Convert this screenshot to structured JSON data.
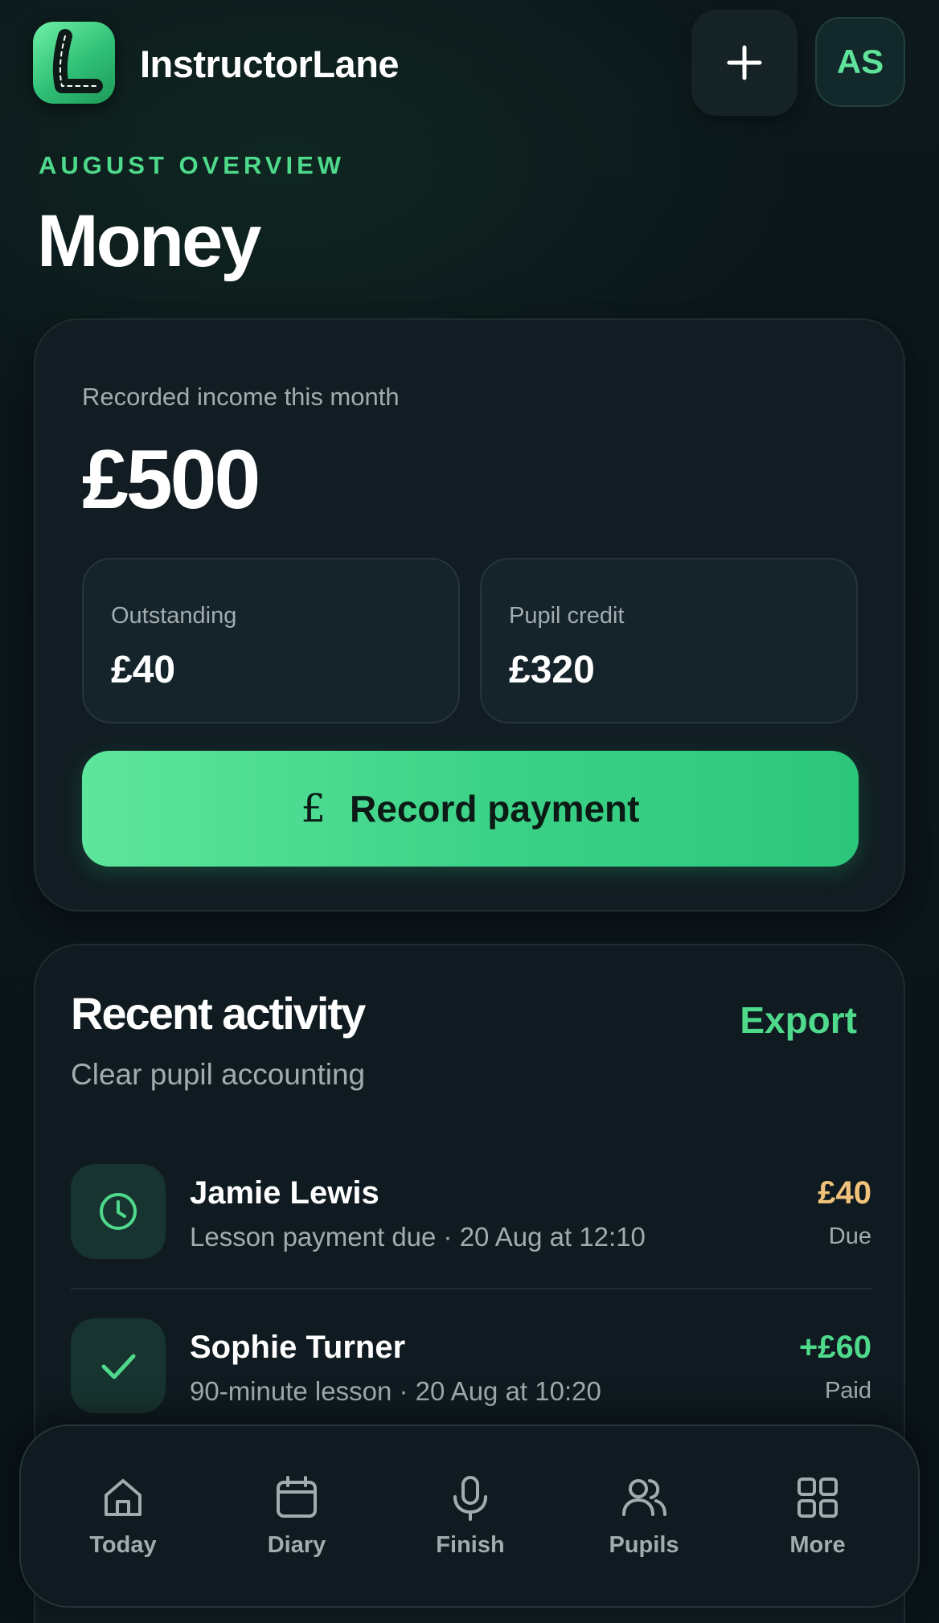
{
  "header": {
    "app_name": "InstructorLane",
    "avatar_initials": "AS",
    "icons": [
      "app-logo",
      "plus-icon"
    ]
  },
  "page": {
    "eyebrow": "AUGUST OVERVIEW",
    "title": "Money"
  },
  "summary": {
    "income_label": "Recorded income this month",
    "income_value": "£500",
    "outstanding_label": "Outstanding",
    "outstanding_value": "£40",
    "credit_label": "Pupil credit",
    "credit_value": "£320",
    "record_button_label": "Record payment",
    "record_button_icon": "£"
  },
  "activity": {
    "title": "Recent activity",
    "subtitle": "Clear pupil accounting",
    "export_label": "Export",
    "items": [
      {
        "name": "Jamie Lewis",
        "detail": "Lesson payment due · 20 Aug at 12:10",
        "amount": "£40",
        "status": "Due",
        "icon": "clock-icon",
        "amount_color": "#f1c27a"
      },
      {
        "name": "Sophie Turner",
        "detail": "90-minute lesson · 20 Aug at 10:20",
        "amount": "+£60",
        "status": "Paid",
        "icon": "check-icon",
        "amount_color": "#4ed98b"
      }
    ]
  },
  "nav": {
    "items": [
      {
        "label": "Today",
        "icon": "home-icon"
      },
      {
        "label": "Diary",
        "icon": "calendar-icon"
      },
      {
        "label": "Finish",
        "icon": "microphone-icon"
      },
      {
        "label": "Pupils",
        "icon": "users-icon"
      },
      {
        "label": "More",
        "icon": "grid-icon"
      }
    ]
  },
  "colors": {
    "accent": "#4ed98b",
    "background": "#0b151a",
    "due": "#f1c27a"
  }
}
